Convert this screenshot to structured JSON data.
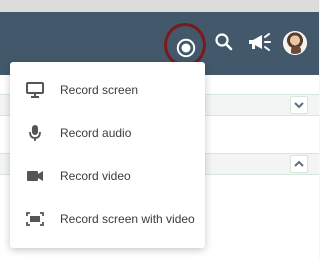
{
  "header": {
    "buttons": {
      "record": {
        "icon": "record-icon"
      },
      "search": {
        "icon": "search-icon"
      },
      "announcements": {
        "icon": "megaphone-icon"
      },
      "profile": {
        "icon": "avatar"
      }
    }
  },
  "record_menu": {
    "items": [
      {
        "label": "Record screen",
        "icon": "monitor-icon"
      },
      {
        "label": "Record audio",
        "icon": "microphone-icon"
      },
      {
        "label": "Record video",
        "icon": "video-camera-icon"
      },
      {
        "label": "Record screen with video",
        "icon": "screen-video-icon"
      }
    ]
  },
  "colors": {
    "header_background": "#43596b",
    "highlight_ring": "#7a1a1a",
    "menu_text": "#3c3c3c"
  }
}
